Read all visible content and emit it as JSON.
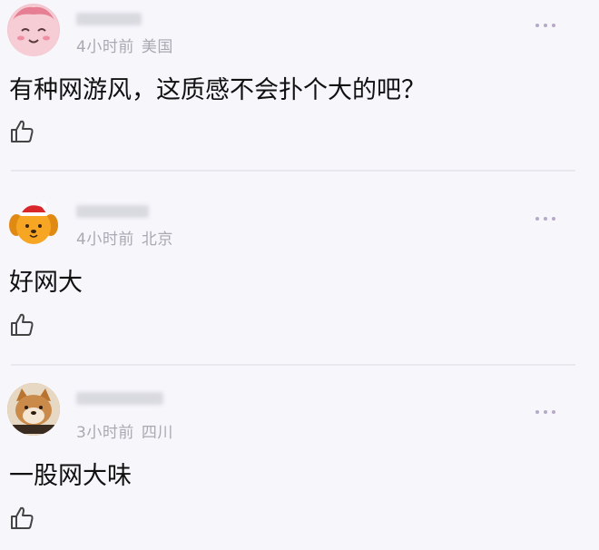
{
  "comments": [
    {
      "time": "4小时前",
      "location": "美国",
      "text": "有种网游风，这质感不会扑个大的吧？",
      "avatar_icon": "pink-smiling-face-avatar",
      "colors": {
        "avatar_bg": "#f3c6cf"
      }
    },
    {
      "time": "4小时前",
      "location": "北京",
      "text": "好网大",
      "avatar_icon": "orange-dog-with-santa-hat-avatar",
      "colors": {
        "avatar_bg": "#f7a623"
      }
    },
    {
      "time": "3小时前",
      "location": "四川",
      "text": "一股网大味",
      "avatar_icon": "shiba-dog-photo-avatar",
      "colors": {
        "avatar_bg": "#c98a4a"
      }
    }
  ],
  "icons": {
    "like": "thumbs-up-icon",
    "more": "more-dots-icon"
  }
}
